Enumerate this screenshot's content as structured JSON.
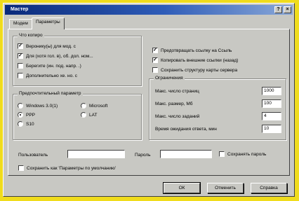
{
  "window": {
    "title": "Мастер",
    "help_glyph": "?",
    "close_glyph": "×"
  },
  "tabs": [
    {
      "label": "Модем"
    },
    {
      "label": "Параметры"
    }
  ],
  "what_to_save": {
    "title": "Что копиро",
    "items": [
      {
        "label": "Веронику(ы) для мод. с",
        "checked": true
      },
      {
        "label": "Для (хотя гол. в), об. дол. ном...",
        "checked": true
      },
      {
        "label": "Берегите (ин. под. напр. .)",
        "checked": false
      },
      {
        "label": "Дополнительно хе. но. с",
        "checked": false
      }
    ]
  },
  "protocol": {
    "title": "Предпочтительный параметр",
    "options": [
      {
        "label": "Windows 3.0(1)",
        "selected": false
      },
      {
        "label": "Microsoft",
        "selected": false
      },
      {
        "label": "PPP",
        "selected": true
      },
      {
        "label": "LAT",
        "selected": false
      },
      {
        "label": "S10",
        "selected": false
      }
    ]
  },
  "top_right": {
    "items": [
      {
        "label": "Предотвращать ссылку на Ссыль",
        "checked": true
      },
      {
        "label": "Копировать внешние ссылки (назад)",
        "checked": true
      },
      {
        "label": "Сохранить структуру карты сервера",
        "checked": false
      }
    ]
  },
  "limits": {
    "title": "Ограничения",
    "rows": [
      {
        "label": "Макс. число страниц",
        "value": "1000"
      },
      {
        "label": "Макс. размер, Мб",
        "value": "100"
      },
      {
        "label": "Макс. число заданий",
        "value": "4"
      },
      {
        "label": "Время ожидания ответа, мин",
        "value": "10"
      }
    ]
  },
  "auth": {
    "user_label": "Пользователь",
    "user_value": "",
    "password_label": "Пароль",
    "password_value": "",
    "save_password_label": "Сохранять пароль",
    "save_password_checked": false
  },
  "save_defaults": {
    "label": "Сохранить как 'Параметры по умолчанию'",
    "checked": false
  },
  "buttons": {
    "ok": "ОК",
    "cancel": "Отменить",
    "help": "Справка"
  }
}
